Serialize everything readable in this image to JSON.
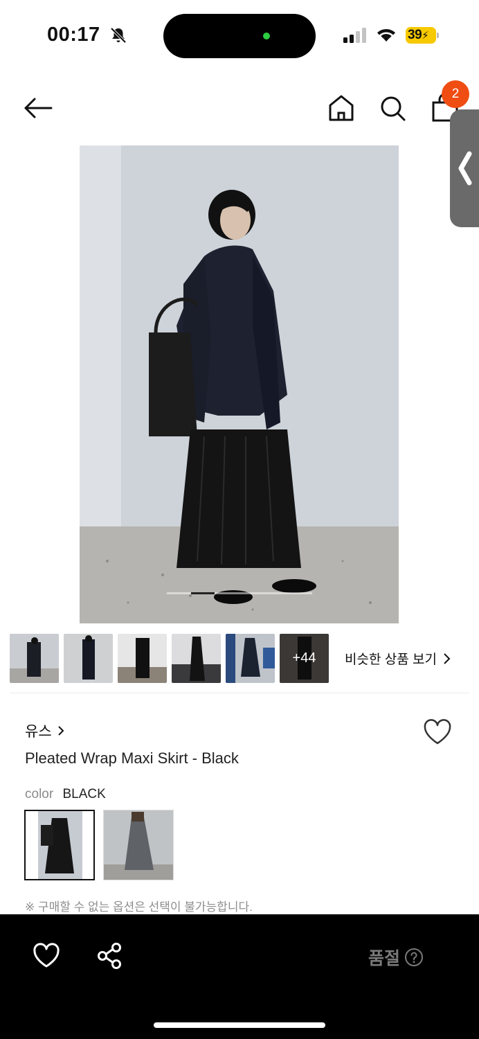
{
  "status_bar": {
    "time": "00:17",
    "battery": "39"
  },
  "header": {
    "cart_count": "2"
  },
  "gallery": {
    "more_count": "+44",
    "similar_label": "비슷한 상품 보기"
  },
  "product": {
    "brand": "유스",
    "name": "Pleated Wrap Maxi Skirt - Black",
    "color_label": "color",
    "color_value": "BLACK",
    "notice": "※ 구매할 수 없는 옵션은 선택이 불가능합니다."
  },
  "bottom_bar": {
    "status": "품절"
  },
  "icons": {
    "back": "back-arrow-icon",
    "home": "home-icon",
    "search": "search-icon",
    "bag": "shopping-bag-icon",
    "wish": "heart-icon",
    "share": "share-icon",
    "help": "question-icon"
  },
  "colors": {
    "badge": "#ef4d12",
    "bottom_bar": "#000000",
    "soldout_text": "#7a7a7a"
  }
}
